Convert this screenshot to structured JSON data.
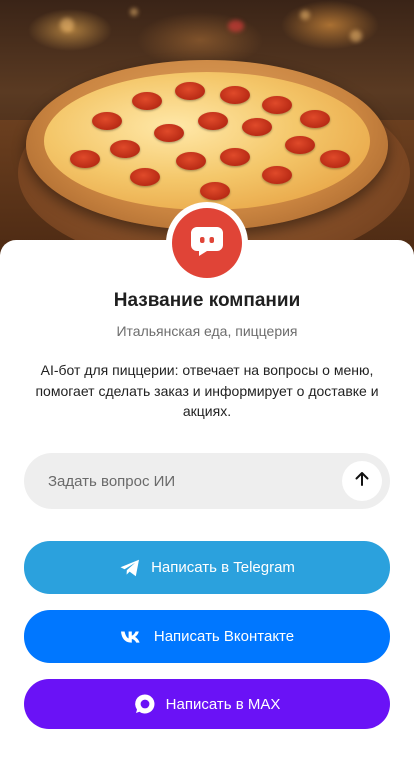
{
  "hero": {
    "image": "pizza-pepperoni-photo"
  },
  "company": {
    "logo_icon": "chat-bot-icon",
    "logo_color": "#e04437",
    "name": "Название компании",
    "category": "Итальянская еда, пиццерия",
    "description": "AI-бот для пиццерии: отвечает на вопросы о меню, помогает сделать заказ и информирует о доставке и акциях."
  },
  "ask": {
    "placeholder": "Задать вопрос ИИ",
    "send_icon": "arrow-up-icon"
  },
  "buttons": {
    "telegram": {
      "label": "Написать в Telegram",
      "icon": "telegram-icon",
      "color": "#2ba1dd"
    },
    "vk": {
      "label": "Написать Вконтакте",
      "icon": "vk-icon",
      "color": "#0077ff"
    },
    "max": {
      "label": "Написать в MAX",
      "icon": "max-icon",
      "color": "#6a12f6"
    }
  }
}
